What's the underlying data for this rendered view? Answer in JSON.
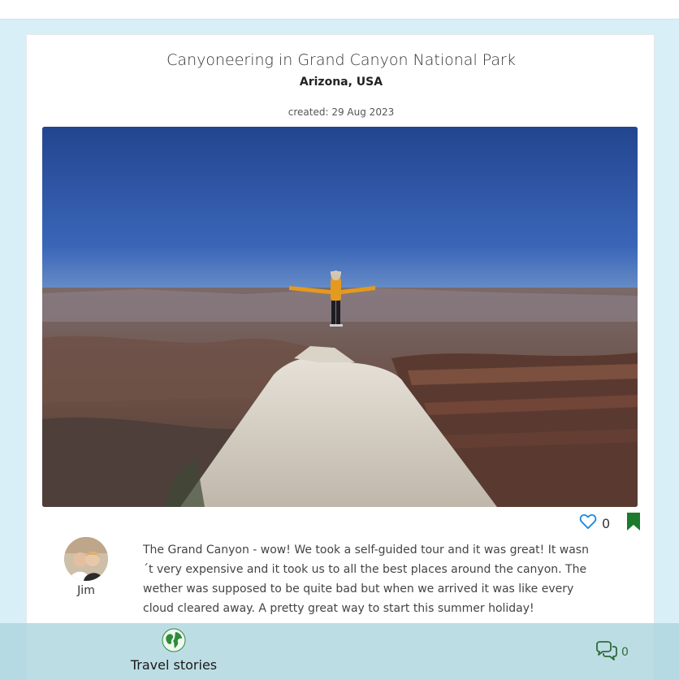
{
  "post": {
    "title": "Canyoneering in Grand Canyon National Park",
    "location": "Arizona, USA",
    "created": "created: 29 Aug 2023",
    "like_count": "0",
    "author": "Jim",
    "body": "The Grand Canyon - wow! We took a self-guided tour and it was great! It wasn´t very expensive and it took us to all the best places around the canyon. The wether was supposed to be quite bad but when we arrived it was like every cloud cleared away. A pretty great way to start this summer holiday!"
  },
  "footer": {
    "brand": "Travel stories",
    "comment_count": "0"
  },
  "icons": {
    "like": "heart-outline-icon",
    "bookmark": "bookmark-icon",
    "comments": "comments-icon",
    "brand": "globe-icon"
  },
  "colors": {
    "accent_blue": "#1e88e5",
    "bookmark_green": "#1b7a2b",
    "background": "#d9eff8"
  }
}
